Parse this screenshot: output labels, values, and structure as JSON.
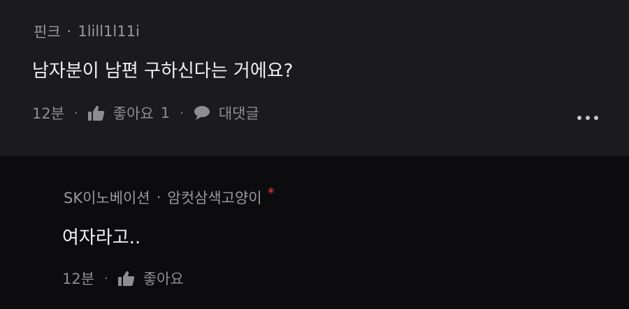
{
  "top_comment": {
    "author": "핀크",
    "nickname": "1lill1l11i",
    "text": "남자분이 남편 구하신다는 거에요?",
    "time": "12분",
    "like_label": "좋아요",
    "like_count": "1",
    "reply_label": "대댓글",
    "more_icon": "more-dots-icon"
  },
  "reply_comment": {
    "author": "SK이노베이션",
    "nickname": "암컷삼색고양이",
    "op_marker": "*",
    "text": "여자라고..",
    "time": "12분",
    "like_label": "좋아요"
  },
  "separator": "·",
  "colors": {
    "top_bg": "#1b1b1d",
    "reply_bg": "#0c0c0e",
    "op_marker": "#e33b3b"
  }
}
